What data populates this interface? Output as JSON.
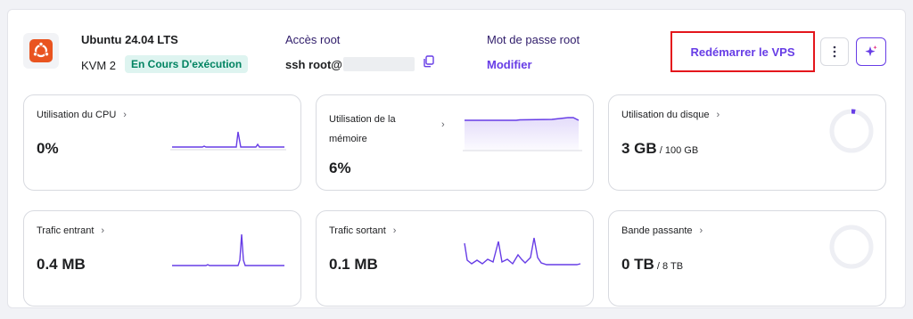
{
  "header": {
    "os_icon": "ubuntu-logo-icon",
    "os_title": "Ubuntu 24.04 LTS",
    "plan": "KVM 2",
    "status": "En Cours D'exécution",
    "root_access_label": "Accès root",
    "ssh_command": "ssh root@",
    "root_password_label": "Mot de passe root",
    "modify_label": "Modifier",
    "restart_label": "Redémarrer le VPS",
    "more_icon": "more-vertical-icon",
    "ai_icon": "sparkle-icon"
  },
  "colors": {
    "accent": "#673de6",
    "ubuntu": "#e95420",
    "status_bg": "#def4f0",
    "status_text": "#008361",
    "highlight_border": "#e4161c"
  },
  "cards": [
    {
      "title": "Utilisation du CPU",
      "value": "0%",
      "sub": ""
    },
    {
      "title": "Utilisation de la",
      "title2": "mémoire",
      "value": "6%",
      "sub": ""
    },
    {
      "title": "Utilisation du disque",
      "value": "3 GB",
      "sub": " / 100 GB",
      "usage": 0.03
    },
    {
      "title": "Trafic entrant",
      "value": "0.4 MB",
      "sub": ""
    },
    {
      "title": "Trafic sortant",
      "value": "0.1 MB",
      "sub": ""
    },
    {
      "title": "Bande passante",
      "value": "0 TB",
      "sub": " / 8 TB",
      "usage": 0
    }
  ]
}
